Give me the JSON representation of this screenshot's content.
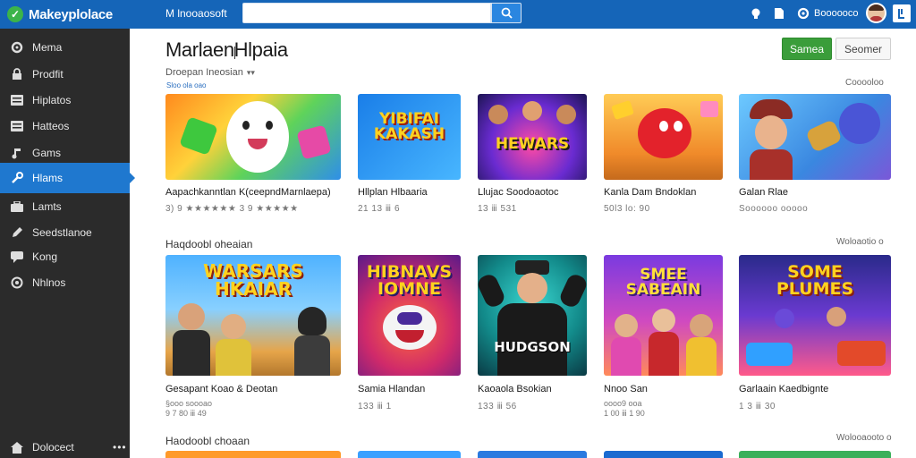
{
  "topbar": {
    "brand": "Makeyplolace",
    "link": "M lnooaosoft",
    "search_value": "",
    "user_name": "Boooooco"
  },
  "sidebar": {
    "items": [
      {
        "label": "Mema",
        "icon": "gear-icon"
      },
      {
        "label": "Prodfit",
        "icon": "lock-icon"
      },
      {
        "label": "Hiplatos",
        "icon": "list-icon"
      },
      {
        "label": "Hatteos",
        "icon": "list-icon"
      },
      {
        "label": "Gams",
        "icon": "music-icon"
      },
      {
        "label": "Hlams",
        "icon": "wrench-icon"
      },
      {
        "label": "Lamts",
        "icon": "briefcase-icon"
      },
      {
        "label": "Seedstlanoe",
        "icon": "pencil-icon"
      },
      {
        "label": "Kong",
        "icon": "chat-icon"
      },
      {
        "label": "Nhlnos",
        "icon": "circle-icon"
      }
    ],
    "active_index": 5,
    "footer": "Dolocect",
    "more": "•••"
  },
  "main": {
    "title": "MarlaenHlpaia",
    "sort_label": "Droepan Ineosian",
    "sort_arrow": "▾▾",
    "tiny_link": "Sloo ola oao",
    "buttons": {
      "primary": "Samea",
      "secondary": "Seomer"
    },
    "top_right_link": "Cooooloo",
    "sections": [
      {
        "heading": "",
        "more": ""
      },
      {
        "heading": "Haqdoobl oheaian",
        "more": "Woloaotio o"
      },
      {
        "heading": "Haodoobl choaan",
        "more": "Wolooaooto o"
      }
    ]
  },
  "row1": [
    {
      "title": "Aapachkanntlan K(ceepndMarnlaepa)",
      "meta": "3) 9 ★★★★★★ 3 9 ★★★★★"
    },
    {
      "title": "Hllplan Hlbaaria",
      "meta": "21 13 ⅲ 6",
      "art": "YIBIFAI KAKASH"
    },
    {
      "title": "Llujac Soodoaotoc",
      "meta": "13 ⅲ 531",
      "art": "HEWARS"
    },
    {
      "title": "Kanla Dam Bndoklan",
      "meta": "50l3 lo: 90",
      "art": ""
    },
    {
      "title": "Galan Rlae",
      "meta": "Soooooo ooooo",
      "art": ""
    }
  ],
  "row2": [
    {
      "title": "Gesapant Koao & Deotan",
      "meta": "§ooo soooao",
      "meta2": "9 7 80 ⅲ 49",
      "art": "WARSARS HKAIAR"
    },
    {
      "title": "Samia Hlandan",
      "meta": "133 ⅲ 1",
      "art": "HIBNAVS IOMNE"
    },
    {
      "title": "Kaoaola Bsokian",
      "meta": "133 ⅲ 56",
      "art": "HUDGSON"
    },
    {
      "title": "Nnoo San",
      "meta": "oooo9 ooa",
      "meta2": "1 00 ⅲ 1 90",
      "art": "SMEE SABEAIN"
    },
    {
      "title": "Garlaain Kaedbignte",
      "meta": "1 3 ⅲ 30",
      "art": "SOME PLUMES"
    }
  ],
  "colors": {
    "topbar": "#1565b8",
    "sidebar": "#2b2b2b",
    "active": "#1f78cf",
    "primary_button": "#3a9d3a"
  }
}
